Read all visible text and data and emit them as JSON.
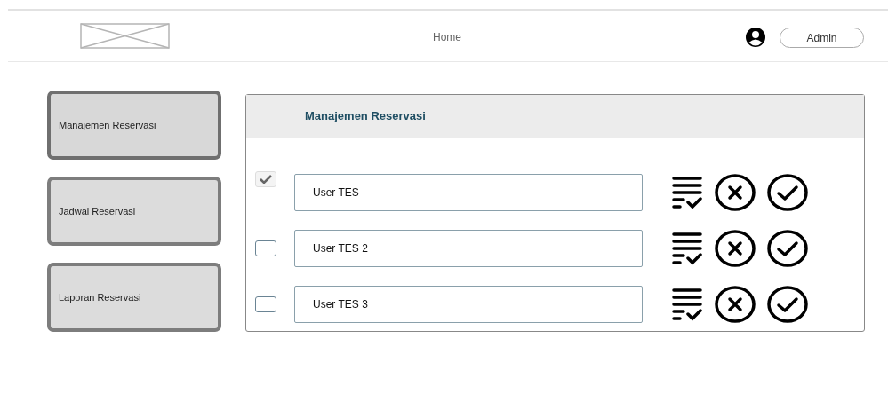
{
  "header": {
    "nav_link": "Home",
    "user_button": "Admin"
  },
  "sidebar": {
    "items": [
      {
        "label": "Manajemen Reservasi",
        "selected": true
      },
      {
        "label": "Jadwal Reservasi",
        "selected": false
      },
      {
        "label": "Laporan Reservasi",
        "selected": false
      }
    ]
  },
  "panel": {
    "title": "Manajemen Reservasi",
    "rows": [
      {
        "checked": true,
        "value": "User TES"
      },
      {
        "checked": false,
        "value": "User TES 2"
      },
      {
        "checked": false,
        "value": "User TES 3"
      }
    ]
  }
}
